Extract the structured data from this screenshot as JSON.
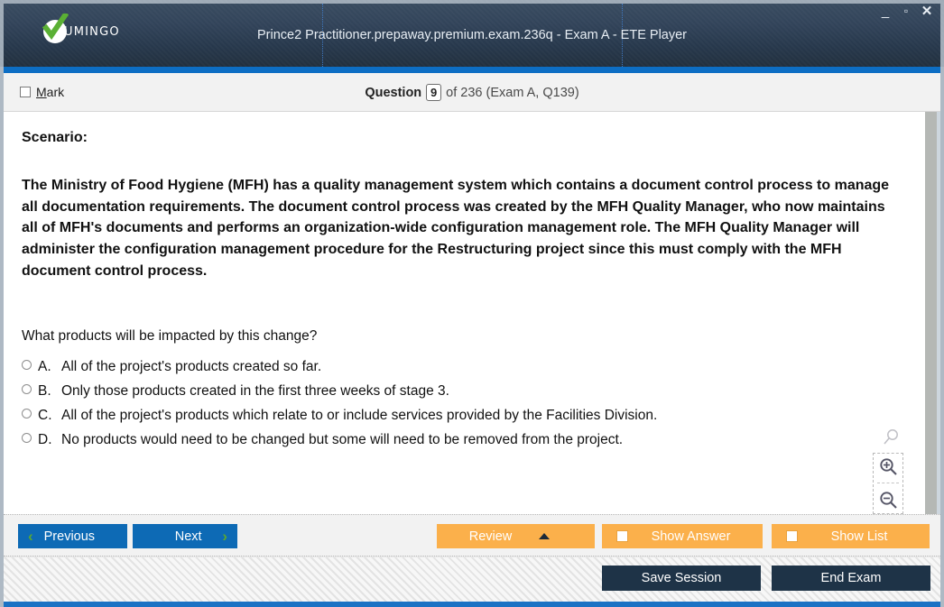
{
  "window": {
    "title": "Prince2 Practitioner.prepaway.premium.exam.236q - Exam A - ETE Player",
    "logo_text": "UMINGO",
    "minimize": "_",
    "maximize": "▫",
    "close": "✕"
  },
  "qheader": {
    "mark_label_first": "M",
    "mark_label_rest": "ark",
    "question_label": "Question",
    "question_number": "9",
    "question_of": "of 236 (Exam A, Q139)"
  },
  "content": {
    "scenario_heading": "Scenario:",
    "scenario_body": "The Ministry of Food Hygiene (MFH) has a quality management system which contains a document control process to manage all documentation requirements. The document control process was created by the MFH Quality Manager, who now maintains all of MFH's documents and performs an organization-wide configuration management role. The MFH Quality Manager will administer the configuration management procedure for the Restructuring project since this must comply with the MFH document control process.",
    "question_text": "What products will be impacted by this change?",
    "options": [
      {
        "letter": "A.",
        "text": "All of the project's products created so far."
      },
      {
        "letter": "B.",
        "text": "Only those products created in the first three weeks of stage 3."
      },
      {
        "letter": "C.",
        "text": "All of the project's products which relate to or include services provided by the Facilities Division."
      },
      {
        "letter": "D.",
        "text": "No products would need to be changed but some will need to be removed from the project."
      }
    ]
  },
  "toolbar": {
    "previous": "Previous",
    "next": "Next",
    "review": "Review",
    "show_answer": "Show Answer",
    "show_list": "Show List"
  },
  "footer": {
    "save_session": "Save Session",
    "end_exam": "End Exam"
  },
  "colors": {
    "titlebar_dark": "#27384c",
    "accent_blue": "#0d6ec4",
    "button_blue": "#0d6ab5",
    "button_orange": "#fbb04b",
    "button_dark": "#1e3347",
    "chevron_green": "#5aa731"
  }
}
